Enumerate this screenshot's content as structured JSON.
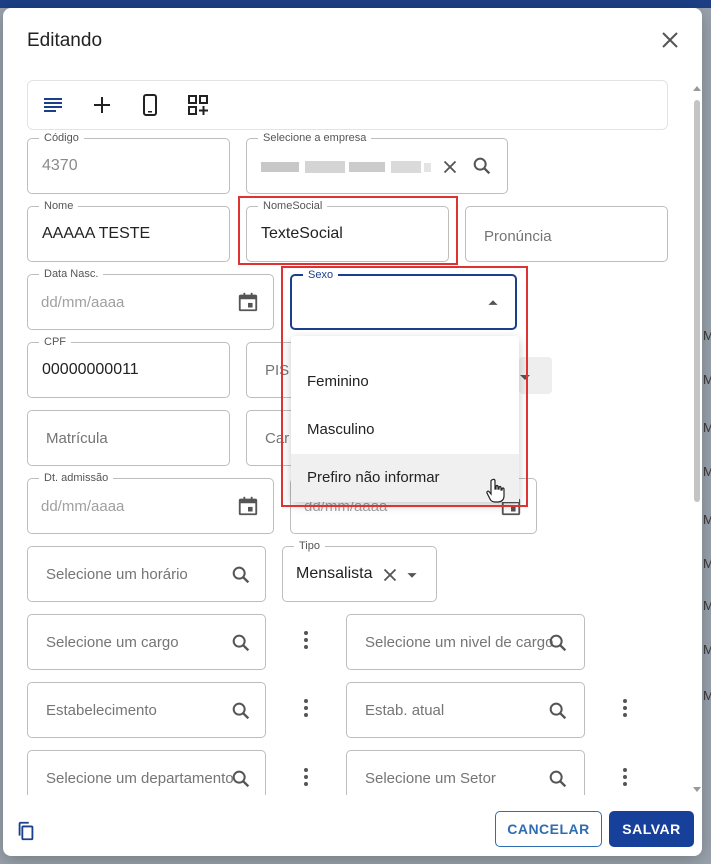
{
  "dialog": {
    "title": "Editando",
    "close_icon": "close-icon"
  },
  "toolbar": {
    "icons": [
      "text-lines-icon",
      "plus-icon",
      "mobile-phone-icon",
      "grid-add-icon"
    ]
  },
  "form": {
    "codigo": {
      "label": "Código",
      "value": "4370"
    },
    "empresa": {
      "label": "Selecione a empresa",
      "value_blurred": true
    },
    "nome": {
      "label": "Nome",
      "value": "AAAAA TESTE"
    },
    "nome_social": {
      "label": "NomeSocial",
      "value": "TexteSocial"
    },
    "pronuncia": {
      "placeholder": "Pronúncia"
    },
    "data_nasc": {
      "label": "Data Nasc.",
      "placeholder": "dd/mm/aaaa"
    },
    "sexo": {
      "label": "Sexo",
      "value": ""
    },
    "cpf": {
      "label": "CPF",
      "value": "00000000011"
    },
    "pis": {
      "placeholder_partial": "PIS"
    },
    "matricula": {
      "placeholder": "Matrícula"
    },
    "car": {
      "placeholder_partial": "Car"
    },
    "dt_admissao": {
      "label": "Dt. admissão",
      "placeholder": "dd/mm/aaaa"
    },
    "second_date": {
      "placeholder": "dd/mm/aaaa"
    },
    "horario": {
      "placeholder": "Selecione um horário"
    },
    "tipo": {
      "label": "Tipo",
      "value": "Mensalista"
    },
    "cargo": {
      "placeholder": "Selecione um cargo"
    },
    "nivel_cargo": {
      "placeholder": "Selecione um nivel de cargo"
    },
    "estabelecimento": {
      "placeholder": "Estabelecimento"
    },
    "estab_atual": {
      "placeholder": "Estab. atual"
    },
    "departamento": {
      "placeholder": "Selecione um departamento"
    },
    "setor": {
      "placeholder": "Selecione um Setor"
    }
  },
  "sexo_options": [
    "Feminino",
    "Masculino",
    "Prefiro não informar"
  ],
  "hovered_option_index": 2,
  "footer": {
    "cancel_label": "CANCELAR",
    "save_label": "SALVAR"
  },
  "colors": {
    "primary": "#17409a",
    "cancel_border": "#2f6db3",
    "highlight_frame": "#d33333",
    "focus_border": "#1b3f8a"
  }
}
